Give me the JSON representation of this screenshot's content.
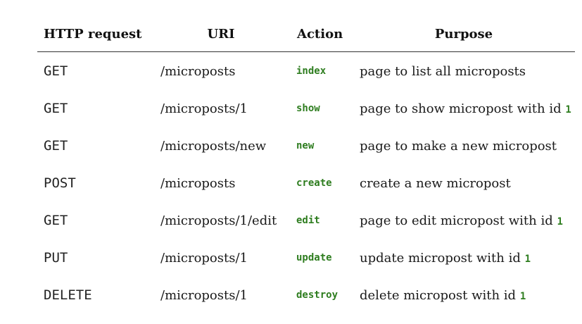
{
  "table": {
    "headers": {
      "http_request": "HTTP request",
      "uri": "URI",
      "action": "Action",
      "purpose": "Purpose"
    },
    "rows": [
      {
        "verb": "GET",
        "uri": "/microposts",
        "action": "index",
        "purpose": "page to list all microposts",
        "purpose_code": ""
      },
      {
        "verb": "GET",
        "uri": "/microposts/1",
        "action": "show",
        "purpose": "page to show micropost with id ",
        "purpose_code": "1"
      },
      {
        "verb": "GET",
        "uri": "/microposts/new",
        "action": "new",
        "purpose": "page to make a new micropost",
        "purpose_code": ""
      },
      {
        "verb": "POST",
        "uri": "/microposts",
        "action": "create",
        "purpose": "create a new micropost",
        "purpose_code": ""
      },
      {
        "verb": "GET",
        "uri": "/microposts/1/edit",
        "action": "edit",
        "purpose": "page to edit micropost with id ",
        "purpose_code": "1"
      },
      {
        "verb": "PUT",
        "uri": "/microposts/1",
        "action": "update",
        "purpose": "update micropost with id ",
        "purpose_code": "1"
      },
      {
        "verb": "DELETE",
        "uri": "/microposts/1",
        "action": "destroy",
        "purpose": "delete micropost with id ",
        "purpose_code": "1"
      }
    ]
  },
  "colors": {
    "code_green": "#2e7d1f",
    "text": "#1a1a1a",
    "rule": "#333333"
  }
}
